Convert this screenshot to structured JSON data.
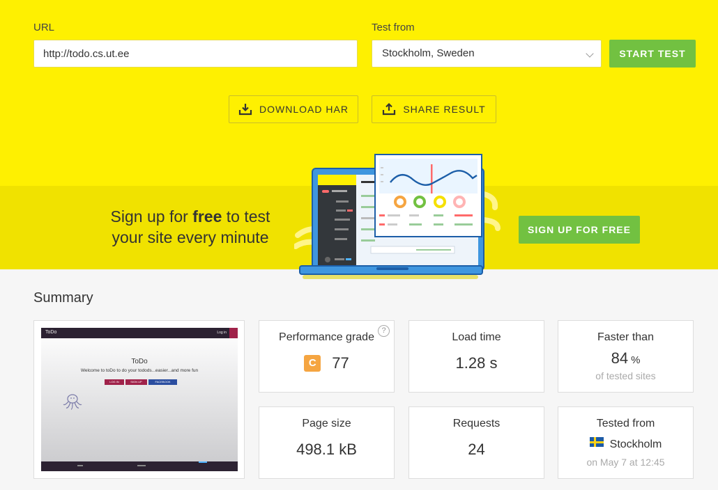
{
  "form": {
    "url_label": "URL",
    "url_value": "http://todo.cs.ut.ee",
    "location_label": "Test from",
    "location_value": "Stockholm, Sweden",
    "start_button": "START TEST",
    "download_har": "DOWNLOAD HAR",
    "share_result": "SHARE RESULT"
  },
  "promo": {
    "line1_pre": "Sign up for ",
    "line1_bold": "free",
    "line1_post": " to test",
    "line2": "your site every minute",
    "signup_button": "SIGN UP FOR FREE"
  },
  "summary": {
    "title": "Summary",
    "performance": {
      "label": "Performance grade",
      "grade": "C",
      "score": "77",
      "help": "?"
    },
    "load_time": {
      "label": "Load time",
      "value": "1.28 s"
    },
    "faster_than": {
      "label": "Faster than",
      "value": "84",
      "unit": "%",
      "sub": "of tested sites"
    },
    "page_size": {
      "label": "Page size",
      "value": "498.1 kB"
    },
    "requests": {
      "label": "Requests",
      "value": "24"
    },
    "tested_from": {
      "label": "Tested from",
      "city": "Stockholm",
      "date": "on May 7 at 12:45"
    }
  },
  "screenshot": {
    "brand": "ToDo",
    "nav_login": "Log in",
    "heading": "ToDo",
    "tagline": "Welcome to toDo to do your todods...easier...and more fun",
    "btn_login": "LOG IN",
    "btn_signup": "SIGN UP",
    "btn_facebook": "FACEBOOK"
  },
  "colors": {
    "header_bg": "#fef001",
    "band_bg": "#f0e200",
    "accent_green": "#72c141",
    "grade_c": "#f5a541"
  }
}
